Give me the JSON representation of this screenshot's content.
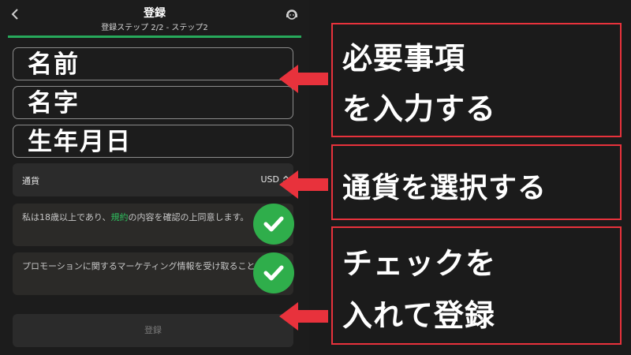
{
  "header": {
    "title": "登録",
    "subtitle": "登録ステップ 2/2 - ステップ2"
  },
  "form": {
    "first_name": "名前",
    "last_name": "名字",
    "birthdate": "生年月日",
    "currency_label": "通貨",
    "currency_value": "USD",
    "consent_age": {
      "before": "私は18歳以上であり、",
      "link": "規約",
      "after": "の内容を確認の上同意します。"
    },
    "consent_marketing": "プロモーションに関するマーケティング情報を受け取ることに同意します",
    "submit_label": "登録"
  },
  "callouts": {
    "required_line1": "必要事項",
    "required_line2": "を入力する",
    "currency": "通貨を選択する",
    "check_line1": "チェックを",
    "check_line2": "入れて登録"
  },
  "colors": {
    "accent_green": "#27a95b",
    "check_green": "#2fae4b",
    "callout_red": "#e8323c"
  },
  "icons": [
    "back-arrow-icon",
    "support-agent-icon",
    "sort-updown-icon",
    "checkmark-icon",
    "red-arrow-icon"
  ]
}
